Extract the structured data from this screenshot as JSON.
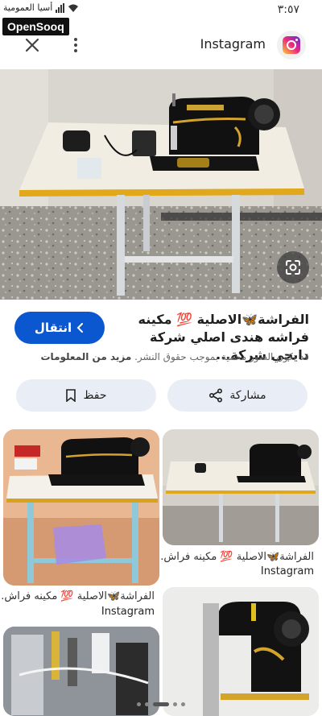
{
  "status_bar": {
    "time": "٣:٥٧",
    "carrier_text": "أسيا العمومية"
  },
  "watermark": {
    "text": "OpenSooq"
  },
  "app_bar": {
    "site_name": "Instagram",
    "icons": [
      "close-icon",
      "more-vert-icon",
      "instagram-logo"
    ]
  },
  "result": {
    "title": "الفراشة🦋الاصلية 💯 مكينه فراشه هندى اصلي شركة دايجي شركة...",
    "visit_label": "انتقال",
    "copyright_notice": "قد تكون الصور محمية بموجب حقوق النشر.",
    "more_info_label": "مزيد من المعلومات",
    "share_label": "مشاركة",
    "save_label": "حفظ"
  },
  "related": [
    {
      "title": "الفراشة🦋الاصلية 💯 مكينه فراش...",
      "source": "Instagram"
    },
    {
      "title": "الفراشة🦋الاصلية 💯 مكينه فراش...",
      "source": "Instagram"
    }
  ],
  "colors": {
    "primary_button": "#0b57d0",
    "pill_button": "#e9eef6"
  }
}
